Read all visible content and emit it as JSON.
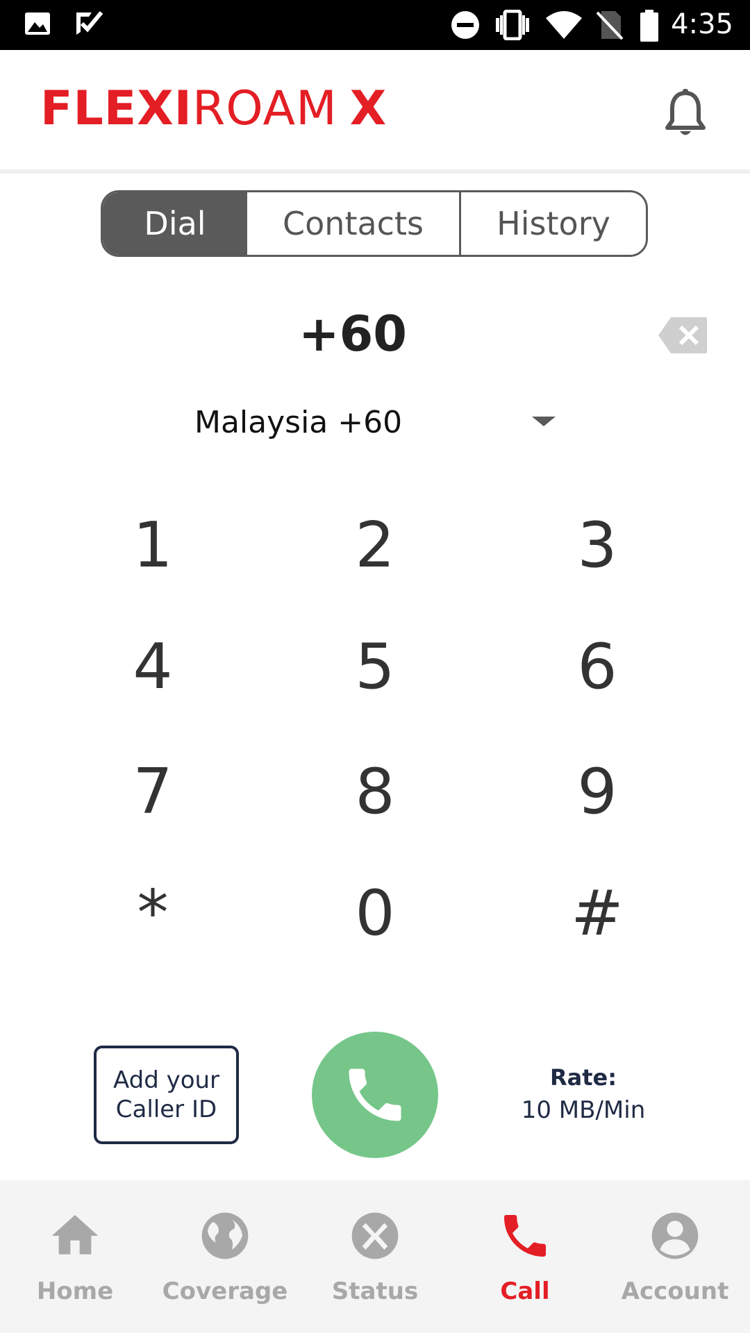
{
  "status_bar": {
    "time": "4:35",
    "left_icons": [
      "image-icon",
      "check-badge-icon"
    ],
    "right_icons": [
      "do-not-disturb-icon",
      "vibrate-icon",
      "wifi-icon",
      "no-sim-icon",
      "battery-icon"
    ]
  },
  "header": {
    "logo_part1": "FLEXI",
    "logo_part2": "ROAM",
    "logo_part3": "X",
    "notification_icon": "bell-icon",
    "brand_color": "#e31e24"
  },
  "tabs": {
    "dial": "Dial",
    "contacts": "Contacts",
    "history": "History",
    "active": "Dial"
  },
  "dialer": {
    "number": "+60",
    "country": "Malaysia +60",
    "backspace_icon": "backspace-icon"
  },
  "keypad": {
    "keys": [
      "1",
      "2",
      "3",
      "4",
      "5",
      "6",
      "7",
      "8",
      "9",
      "*",
      "0",
      "#"
    ]
  },
  "actions": {
    "caller_id_line1": "Add your",
    "caller_id_line2": "Caller ID",
    "call_icon": "phone-icon",
    "call_color": "#76c68a",
    "rate_label": "Rate:",
    "rate_value": "10 MB/Min"
  },
  "nav": {
    "items": [
      {
        "label": "Home",
        "icon": "home-icon"
      },
      {
        "label": "Coverage",
        "icon": "globe-icon"
      },
      {
        "label": "Status",
        "icon": "x-circle-icon"
      },
      {
        "label": "Call",
        "icon": "phone-icon"
      },
      {
        "label": "Account",
        "icon": "account-icon"
      }
    ],
    "active": "Call",
    "active_color": "#e31e24",
    "inactive_color": "#a8a8a8"
  }
}
